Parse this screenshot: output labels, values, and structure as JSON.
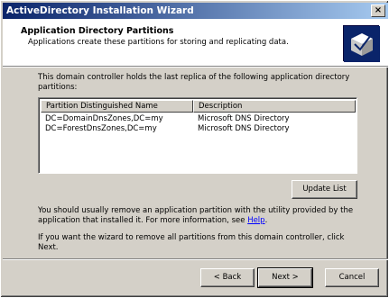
{
  "window": {
    "title": "ActiveDirectory Installation Wizard",
    "close_label": "×"
  },
  "header": {
    "title": "Application Directory Partitions",
    "subtitle": "Applications create these partitions for storing and replicating data."
  },
  "intro": "This domain controller holds the last replica of the following application directory partitions:",
  "table": {
    "columns": [
      "Partition Distinguished Name",
      "Description"
    ],
    "rows": [
      {
        "name": "DC=DomainDnsZones,DC=my",
        "description": "Microsoft DNS Directory"
      },
      {
        "name": "DC=ForestDnsZones,DC=my",
        "description": "Microsoft DNS Directory"
      }
    ]
  },
  "update_button": "Update List",
  "para1": {
    "text": "You should usually remove an application partition with the utility provided by the application that installed it. For more information, see ",
    "link": "Help",
    "tail": "."
  },
  "para2": "If you want the wizard to remove all partitions from this domain controller, click Next.",
  "buttons": {
    "back": "< Back",
    "next": "Next >",
    "cancel": "Cancel"
  },
  "icons": {
    "header": "wizard-directory-icon",
    "close": "close-icon"
  }
}
